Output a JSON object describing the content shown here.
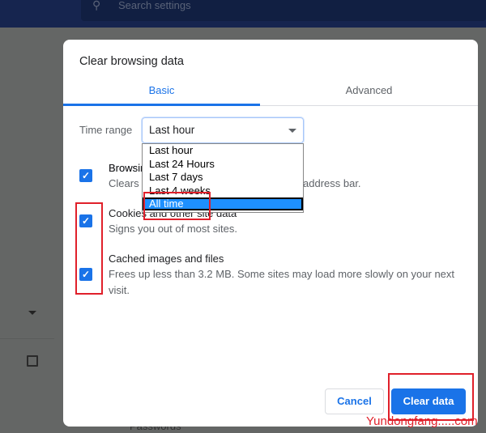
{
  "header": {
    "search_placeholder": "Search settings",
    "search_icon": "search-icon"
  },
  "background": {
    "passwords_label": "Passwords"
  },
  "dialog": {
    "title": "Clear browsing data",
    "tabs": [
      {
        "label": "Basic",
        "active": true
      },
      {
        "label": "Advanced",
        "active": false
      }
    ],
    "time_range": {
      "label": "Time range",
      "value": "Last hour",
      "options": [
        "Last hour",
        "Last 24 Hours",
        "Last 7 days",
        "Last 4 weeks",
        "All time"
      ],
      "highlighted": "All time"
    },
    "items": [
      {
        "title": "Browsing history",
        "visible_title": "Browsi",
        "description": "Clears history and autocompletions in the address bar.",
        "visible_desc_start": "Clears",
        "visible_desc_end": "address bar.",
        "checked": true
      },
      {
        "title": "Cookies and other site data",
        "description": "Signs you out of most sites.",
        "checked": true
      },
      {
        "title": "Cached images and files",
        "description": "Frees up less than 3.2 MB. Some sites may load more slowly on your next visit.",
        "checked": true
      }
    ],
    "cancel_label": "Cancel",
    "clear_label": "Clear data",
    "accent": "#1a73e8"
  },
  "watermark": "Yundongfang.....com"
}
